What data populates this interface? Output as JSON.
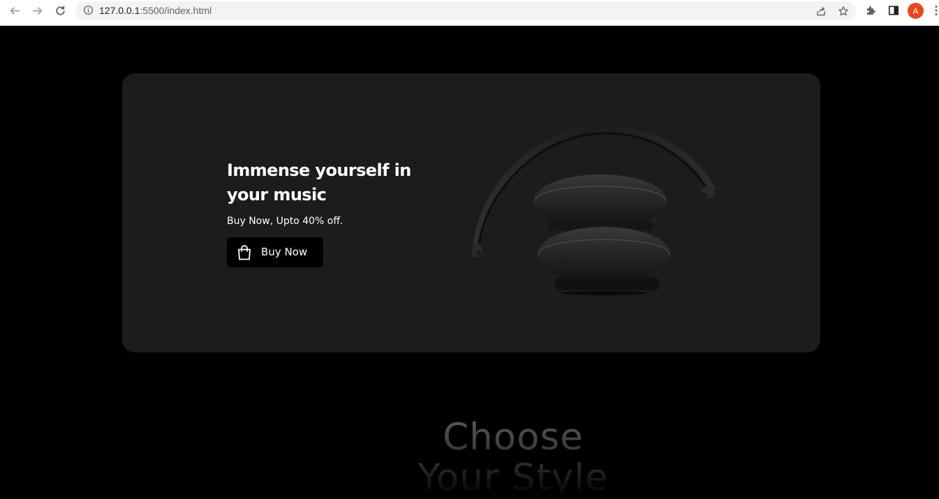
{
  "browser": {
    "url_host": "127.0.0.1",
    "url_rest": ":5500/index.html",
    "profile_initial": "A"
  },
  "hero": {
    "title": "Immense yourself in your music",
    "subtitle": "Buy Now, Upto 40% off.",
    "cta_label": "Buy Now"
  },
  "section": {
    "heading_line1": "Choose",
    "heading_line2": "Your Style"
  },
  "colors": {
    "page_bg": "#000000",
    "card_bg": "#1b1c1e",
    "avatar": "#e8471b"
  }
}
